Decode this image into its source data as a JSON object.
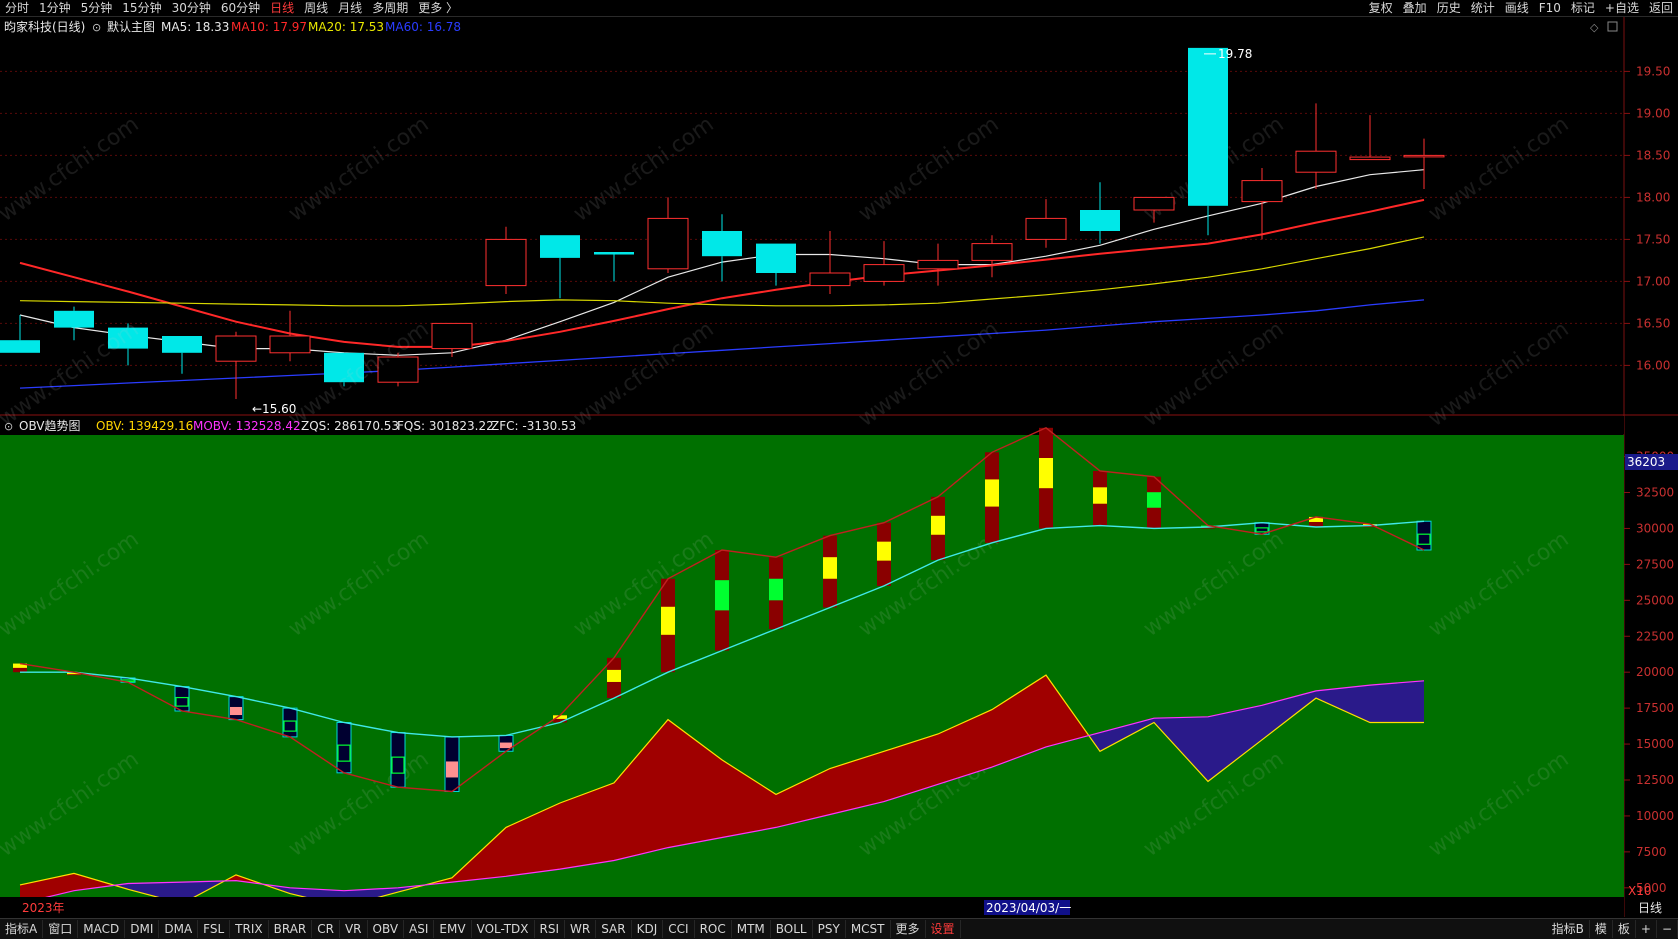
{
  "topbar": {
    "left_items": [
      "分时",
      "1分钟",
      "5分钟",
      "15分钟",
      "30分钟",
      "60分钟",
      "日线",
      "周线",
      "月线",
      "多周期",
      "更多 〉"
    ],
    "active": "日线",
    "right_items": [
      "复权",
      "叠加",
      "历史",
      "统计",
      "画线",
      "F10",
      "标记",
      "+自选",
      "返回"
    ]
  },
  "price_panel": {
    "stock_name": "昀家科技(日线)",
    "template_label": "默认主图",
    "ma_labels": [
      {
        "text": "MA5: 18.33",
        "color": "#e8e8e8"
      },
      {
        "text": "MA10: 17.97",
        "color": "#ff2828"
      },
      {
        "text": "MA20: 17.53",
        "color": "#e8e800"
      },
      {
        "text": "MA60: 16.78",
        "color": "#2a3cff"
      }
    ],
    "high_label": "19.78",
    "low_label": "15.60",
    "axis_ticks": [
      "19.50",
      "19.00",
      "18.50",
      "18.00",
      "17.50",
      "17.00",
      "16.50",
      "16.00"
    ]
  },
  "obv_panel": {
    "title": "OBV趋势图",
    "indicators": [
      {
        "text": "OBV: 139429.16",
        "color": "#ffd400"
      },
      {
        "text": "MOBV: 132528.42",
        "color": "#ff33ff"
      },
      {
        "text": "ZQS: 286170.53",
        "color": "#e8e8e8"
      },
      {
        "text": "FQS: 301823.22",
        "color": "#e8e8e8"
      },
      {
        "text": "ZFC: -3130.53",
        "color": "#e8e8e8"
      }
    ],
    "axis_ticks": [
      "35000",
      "32500",
      "30000",
      "27500",
      "25000",
      "22500",
      "20000",
      "17500",
      "15000",
      "12500",
      "10000",
      "7500",
      "5000"
    ],
    "current_value_label": "36203",
    "scale_label": "X10",
    "year_label": "2023年",
    "date_label": "2023/04/03/一",
    "period_label": "日线"
  },
  "watermark": "www.cfchi.com",
  "bottombar": {
    "tabs": [
      "指标A",
      "窗口",
      "MACD",
      "DMI",
      "DMA",
      "FSL",
      "TRIX",
      "BRAR",
      "CR",
      "VR",
      "OBV",
      "ASI",
      "EMV",
      "VOL-TDX",
      "RSI",
      "WR",
      "SAR",
      "KDJ",
      "CCI",
      "ROC",
      "MTM",
      "BOLL",
      "PSY",
      "MCST",
      "更多",
      "设置"
    ],
    "red_tab": "设置",
    "right_tabs": [
      "指标B",
      "模",
      "板",
      "+",
      "−"
    ]
  },
  "chart_data": [
    {
      "type": "candlestick",
      "title": "昀家科技(日线)",
      "ylim": [
        15.4,
        19.9
      ],
      "ohlc": [
        [
          16.3,
          16.6,
          16.15,
          16.15
        ],
        [
          16.65,
          16.7,
          16.3,
          16.45
        ],
        [
          16.45,
          16.5,
          16.0,
          16.2
        ],
        [
          16.35,
          16.35,
          15.9,
          16.15
        ],
        [
          16.05,
          16.4,
          15.6,
          16.35
        ],
        [
          16.15,
          16.65,
          16.05,
          16.35
        ],
        [
          16.15,
          16.15,
          15.75,
          15.8
        ],
        [
          15.8,
          16.15,
          15.75,
          16.1
        ],
        [
          16.2,
          16.5,
          16.1,
          16.5
        ],
        [
          16.95,
          17.65,
          16.85,
          17.5
        ],
        [
          17.55,
          17.55,
          16.8,
          17.28
        ],
        [
          17.35,
          17.35,
          17.0,
          17.32
        ],
        [
          17.15,
          18.0,
          17.1,
          17.75
        ],
        [
          17.6,
          17.8,
          17.0,
          17.3
        ],
        [
          17.45,
          17.45,
          16.95,
          17.1
        ],
        [
          16.95,
          17.6,
          16.85,
          17.1
        ],
        [
          17.0,
          17.48,
          16.95,
          17.2
        ],
        [
          17.15,
          17.45,
          16.95,
          17.25
        ],
        [
          17.25,
          17.55,
          17.05,
          17.45
        ],
        [
          17.5,
          17.98,
          17.4,
          17.75
        ],
        [
          17.85,
          18.18,
          17.45,
          17.6
        ],
        [
          17.85,
          17.98,
          17.7,
          18.0
        ],
        [
          19.78,
          19.78,
          17.55,
          17.9
        ],
        [
          17.95,
          18.35,
          17.5,
          18.2
        ],
        [
          18.3,
          19.12,
          18.1,
          18.55
        ],
        [
          18.45,
          18.98,
          18.45,
          18.48
        ],
        [
          18.5,
          18.7,
          18.1,
          18.5
        ]
      ],
      "series": [
        {
          "name": "MA5",
          "values": [
            16.6,
            16.45,
            16.36,
            16.28,
            16.2,
            16.2,
            16.15,
            16.12,
            16.15,
            16.3,
            16.52,
            16.75,
            17.05,
            17.23,
            17.32,
            17.32,
            17.27,
            17.2,
            17.2,
            17.3,
            17.43,
            17.62,
            17.78,
            17.93,
            18.13,
            18.27,
            18.33
          ]
        },
        {
          "name": "MA10",
          "values": [
            17.22,
            17.05,
            16.88,
            16.7,
            16.52,
            16.38,
            16.28,
            16.22,
            16.22,
            16.29,
            16.4,
            16.53,
            16.67,
            16.8,
            16.9,
            16.99,
            17.07,
            17.13,
            17.19,
            17.26,
            17.33,
            17.39,
            17.45,
            17.56,
            17.7,
            17.83,
            17.97
          ]
        },
        {
          "name": "MA20",
          "values": [
            16.77,
            16.76,
            16.75,
            16.74,
            16.73,
            16.72,
            16.71,
            16.71,
            16.73,
            16.76,
            16.78,
            16.77,
            16.74,
            16.72,
            16.71,
            16.71,
            16.72,
            16.74,
            16.79,
            16.84,
            16.9,
            16.97,
            17.05,
            17.15,
            17.27,
            17.39,
            17.53
          ]
        },
        {
          "name": "MA60",
          "values": [
            15.73,
            15.76,
            15.79,
            15.82,
            15.85,
            15.88,
            15.91,
            15.94,
            15.98,
            16.02,
            16.06,
            16.1,
            16.14,
            16.18,
            16.22,
            16.26,
            16.3,
            16.34,
            16.38,
            16.42,
            16.47,
            16.52,
            16.56,
            16.6,
            16.65,
            16.72,
            16.78
          ]
        }
      ]
    },
    {
      "type": "line",
      "title": "OBV趋势图",
      "ylim": [
        4500,
        36500
      ],
      "series": [
        {
          "name": "ZQS",
          "values": [
            20000,
            20000,
            19600,
            19000,
            18300,
            17500,
            16500,
            15800,
            15500,
            15600,
            16500,
            18200,
            20000,
            21500,
            23000,
            24500,
            26000,
            27800,
            29000,
            30000,
            30200,
            30000,
            30100,
            30400,
            30100,
            30200,
            30500
          ]
        },
        {
          "name": "FQS",
          "values": [
            20600,
            20000,
            19300,
            17300,
            16700,
            15500,
            13000,
            12000,
            11700,
            14500,
            17000,
            21000,
            26500,
            28500,
            28000,
            29500,
            30400,
            32200,
            35300,
            37000,
            34000,
            33600,
            30200,
            29600,
            30800,
            30300,
            28500
          ]
        },
        {
          "name": "OBV",
          "values": [
            5200,
            6000,
            4900,
            3900,
            5900,
            4600,
            3700,
            4700,
            5700,
            9200,
            10900,
            12300,
            16700,
            13900,
            11500,
            13300,
            14500,
            15700,
            17400,
            19800,
            14500,
            16500,
            12400,
            15300,
            18200,
            16500,
            16500
          ]
        },
        {
          "name": "MOBV",
          "values": [
            3900,
            4800,
            5300,
            5400,
            5500,
            5000,
            4800,
            5000,
            5400,
            5800,
            6300,
            6900,
            7800,
            8500,
            9200,
            10100,
            11000,
            12200,
            13400,
            14800,
            15800,
            16800,
            16900,
            17700,
            18700,
            19100,
            19400
          ]
        }
      ]
    }
  ]
}
